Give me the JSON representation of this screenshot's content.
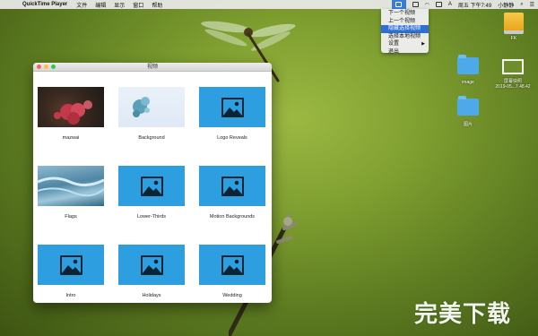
{
  "menubar": {
    "app_name": "QuickTime Player",
    "menus": [
      "文件",
      "编辑",
      "显示",
      "窗口",
      "帮助"
    ],
    "clock": "周五 下午7:49",
    "user": "小静静"
  },
  "status_menu": {
    "items": [
      {
        "label": "下一个视频"
      },
      {
        "label": "上一个视频"
      },
      {
        "label": "隐藏选择视频",
        "active": true
      },
      {
        "label": "选择本地视频"
      },
      {
        "label": "设置",
        "arrow": "▶"
      },
      {
        "label": "退出"
      }
    ]
  },
  "desktop": {
    "drive_label": "FK",
    "folder_image_label": "image",
    "screenshot_label_1": "屏幕快照",
    "screenshot_label_2": "2019-05...7.48.42",
    "folder_pictures_label": "图片"
  },
  "window": {
    "title": "视频",
    "items": [
      {
        "label": "mazwai",
        "thumb": "flower"
      },
      {
        "label": "Background",
        "thumb": "bubble"
      },
      {
        "label": "Logo Reveals",
        "thumb": "placeholder"
      },
      {
        "label": "Flags",
        "thumb": "water"
      },
      {
        "label": "Lower-Thirds",
        "thumb": "placeholder"
      },
      {
        "label": "Motion Backgrounds",
        "thumb": "placeholder"
      },
      {
        "label": "Intro",
        "thumb": "placeholder"
      },
      {
        "label": "Holidays",
        "thumb": "placeholder"
      },
      {
        "label": "Wedding",
        "thumb": "placeholder"
      }
    ]
  },
  "watermark": "完美下载",
  "colors": {
    "accent": "#2d9fe0",
    "menu_highlight": "#2d6fd4"
  }
}
